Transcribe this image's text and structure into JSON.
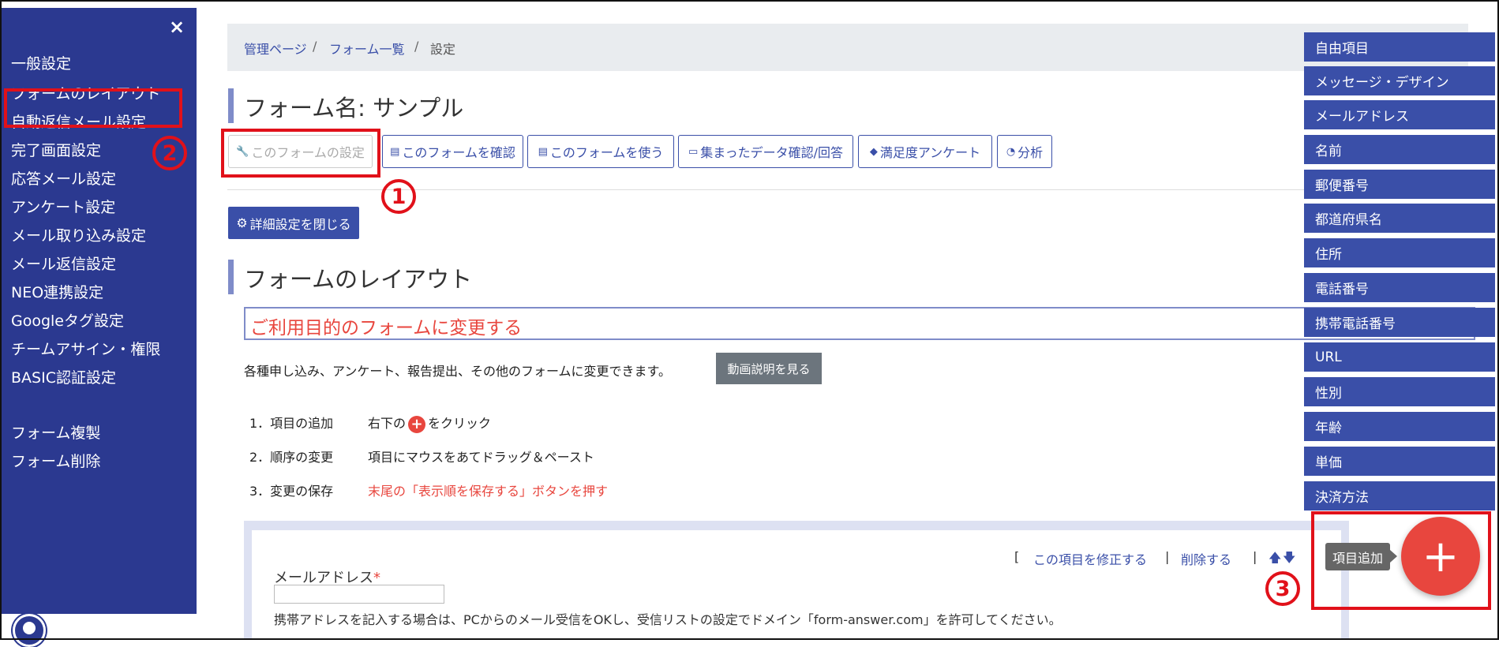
{
  "sidebar": {
    "close_symbol": "×",
    "items": [
      {
        "label": "一般設定"
      },
      {
        "label": "フォームのレイアウト"
      },
      {
        "label": "自動返信メール設定"
      },
      {
        "label": "完了画面設定"
      },
      {
        "label": "応答メール設定"
      },
      {
        "label": "アンケート設定"
      },
      {
        "label": "メール取り込み設定"
      },
      {
        "label": "メール返信設定"
      },
      {
        "label": "NEO連携設定"
      },
      {
        "label": "Googleタグ設定"
      },
      {
        "label": "チームアサイン・権限"
      },
      {
        "label": "BASIC認証設定"
      }
    ],
    "bottom_items": [
      {
        "label": "フォーム複製"
      },
      {
        "label": "フォーム削除"
      }
    ]
  },
  "breadcrumb": {
    "items": [
      "管理ページ",
      "フォーム一覧",
      "設定"
    ],
    "separator": "/"
  },
  "form_title": "フォーム名: サンプル",
  "toolbar": {
    "buttons": [
      {
        "label": "このフォームの設定",
        "icon": "wrench-icon"
      },
      {
        "label": "このフォームを確認",
        "icon": "document-icon"
      },
      {
        "label": "このフォームを使う",
        "icon": "document-icon"
      },
      {
        "label": "集まったデータ確認/回答",
        "icon": "comment-icon"
      },
      {
        "label": "満足度アンケート",
        "icon": "layers-icon"
      },
      {
        "label": "分析",
        "icon": "chart-icon"
      }
    ]
  },
  "detail_close_label": "詳細設定を閉じる",
  "section_title": "フォームのレイアウト",
  "purpose": {
    "title": "ご利用目的のフォームに変更する",
    "description": "各種申し込み、アンケート、報告提出、その他のフォームに変更できます。",
    "video_button": "動画説明を見る"
  },
  "steps": [
    {
      "num": "1．項目の追加",
      "text_before": "右下の",
      "text_after": "をクリック"
    },
    {
      "num": "2．順序の変更",
      "text": "項目にマウスをあてドラッグ＆ペースト"
    },
    {
      "num": "3．変更の保存",
      "text": "末尾の「表示順を保存する」ボタンを押す"
    }
  ],
  "field": {
    "label": "メールアドレス",
    "required_mark": "*",
    "help": "携帯アドレスを記入する場合は、PCからのメール受信をOKし、受信リストの設定でドメイン「form-answer.com」を許可してください。",
    "bracket_open": "[",
    "edit_link": "この項目を修正する",
    "sep": "|",
    "delete_link": "削除する",
    "up_arrow": "🡅",
    "down_arrow": "🡇"
  },
  "palette": {
    "items": [
      "自由項目",
      "メッセージ・デザイン",
      "メールアドレス",
      "名前",
      "郵便番号",
      "都道府県名",
      "住所",
      "電話番号",
      "携帯電話番号",
      "URL",
      "性別",
      "年齢",
      "単価",
      "決済方法"
    ],
    "tooltip": "項目追加",
    "fab_symbol": "+"
  },
  "annotations": {
    "one": "1",
    "two": "2",
    "three": "3"
  },
  "colors": {
    "sidebar": "#2b3990",
    "primary": "#3a4fa8",
    "accent_red": "#e8463e",
    "annotation_red": "#e1111a"
  }
}
